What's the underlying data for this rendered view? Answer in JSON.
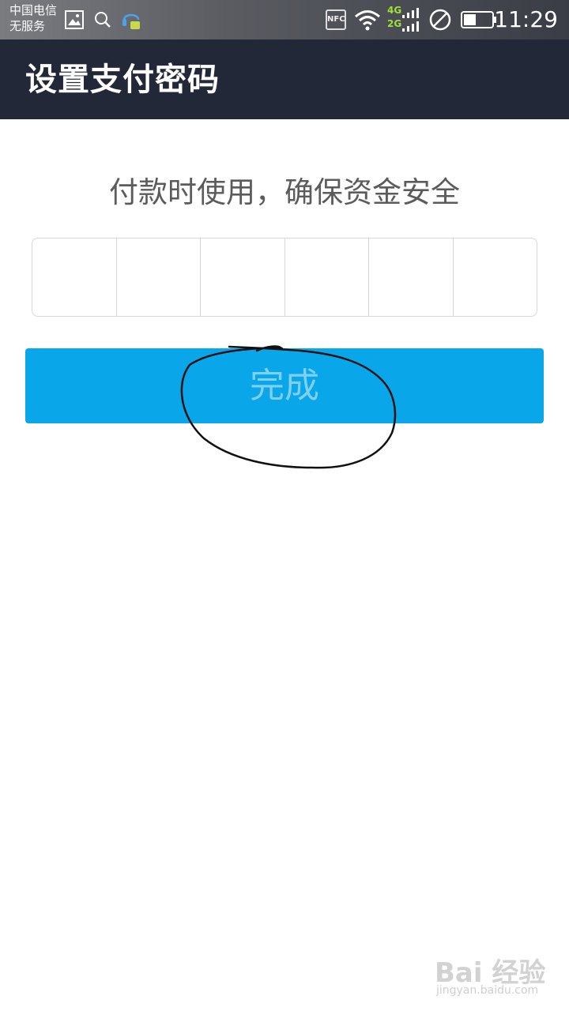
{
  "status_bar": {
    "carrier_line1": "中国电信",
    "carrier_line2": "无服务",
    "nfc": "NFC",
    "net_4g": "4G",
    "net_2g": "2G",
    "time": "11:29"
  },
  "header": {
    "title": "设置支付密码"
  },
  "main": {
    "subtitle": "付款时使用，确保资金安全",
    "pin_digits": [
      "",
      "",
      "",
      "",
      "",
      ""
    ],
    "done_label": "完成"
  },
  "watermark": {
    "brand": "Bai 经验",
    "url": "jingyan.baidu.com"
  },
  "colors": {
    "header_bg": "#232838",
    "button_bg": "#0aa6ea",
    "button_text": "#7fd0f2"
  }
}
